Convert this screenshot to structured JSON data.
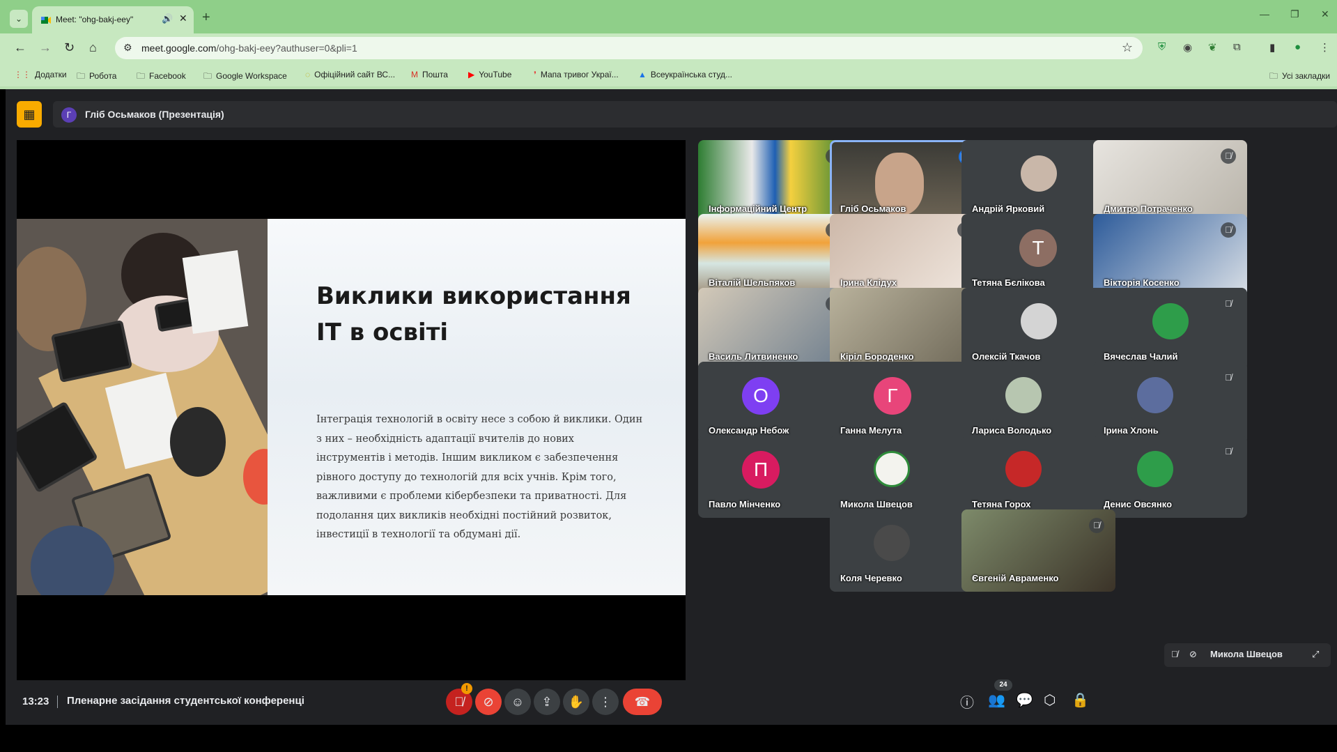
{
  "browser": {
    "tab_title": "Meet: \"ohg-bakj-eey\"",
    "url_host": "meet.google.com",
    "url_path": "/ohg-bakj-eey?authuser=0&pli=1",
    "bookmarks": [
      {
        "label": "Додатки",
        "icon": "apps-grid-icon"
      },
      {
        "label": "Робота",
        "icon": "folder-icon"
      },
      {
        "label": "Facebook",
        "icon": "folder-icon"
      },
      {
        "label": "Google Workspace",
        "icon": "folder-icon"
      },
      {
        "label": "Офіційний сайт ВС...",
        "icon": "site-icon"
      },
      {
        "label": "Пошта",
        "icon": "gmail-icon"
      },
      {
        "label": "YouTube",
        "icon": "youtube-icon"
      },
      {
        "label": "Мапа тривог Украї...",
        "icon": "map-icon"
      },
      {
        "label": "Всеукраїнська студ...",
        "icon": "drive-icon"
      }
    ],
    "all_bookmarks": "Усі закладки"
  },
  "meet": {
    "presenter_avatar": "Г",
    "presenter_label": "Гліб Осьмаков (Презентація)",
    "slide": {
      "title_line1": "Виклики використання",
      "title_line2": "ІТ в освіті",
      "body": "Інтеграція технологій в освіту несе з собою й виклики. Один з них – необхідність адаптації вчителів до нових інструментів і методів. Іншим викликом є забезпечення рівного доступу до технологій для всіх учнів. Крім того, важливими є проблеми кібербезпеки та приватності. Для подолання цих викликів необхідні постійний розвиток, інвестиції в технології та обдумані дії."
    },
    "participants": [
      {
        "name": "Інформаційний Центр"
      },
      {
        "name": "Гліб Осьмаков"
      },
      {
        "name": "Андрій Ярковий"
      },
      {
        "name": "Дмитро Потраченко"
      },
      {
        "name": "Віталій Шельпяков"
      },
      {
        "name": "Ірина Клідух"
      },
      {
        "name": "Тетяна Бєлікова",
        "letter": "Т"
      },
      {
        "name": "Вікторія Косенко"
      },
      {
        "name": "Василь Литвиненко"
      },
      {
        "name": "Кіріл Бороденко"
      },
      {
        "name": "Олексій Ткачов"
      },
      {
        "name": "Вячеслав Чалий"
      },
      {
        "name": "Олександр Небож",
        "letter": "О"
      },
      {
        "name": "Ганна Мелута",
        "letter": "Г"
      },
      {
        "name": "Лариса Володько"
      },
      {
        "name": "Ірина Хлонь"
      },
      {
        "name": "Павло Мінченко",
        "letter": "П"
      },
      {
        "name": "Микола Швецов"
      },
      {
        "name": "Тетяна Горох"
      },
      {
        "name": "Денис Овсянко"
      },
      {
        "name": "Коля Черевко"
      },
      {
        "name": "Євгеній Авраменко"
      }
    ],
    "self_view_name": "Микола Швецов",
    "time": "13:23",
    "meeting_title": "Пленарне засідання студентської конференці",
    "participant_count": "24",
    "alert_mark": "!"
  },
  "colors": {
    "tab_strip": "#8fcf89",
    "toolbar": "#c7e8c0",
    "meet_bg": "#202124",
    "tile_bg": "#3c4043",
    "end_call": "#ea4335",
    "presenter_icon": "#f9ab00",
    "avatar_t": "#8d6e63",
    "avatar_o": "#7e3ff2",
    "avatar_g": "#e8457a",
    "avatar_p": "#d81b60"
  }
}
